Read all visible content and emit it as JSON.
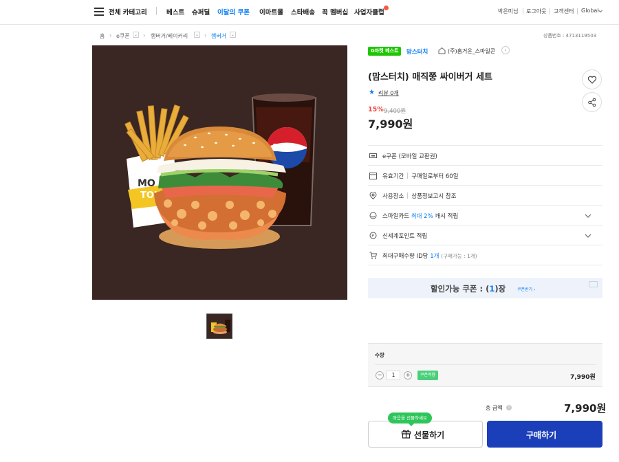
{
  "nav": {
    "all_categories": "전체 카테고리",
    "menus": [
      {
        "label": "베스트",
        "active": false
      },
      {
        "label": "슈퍼딜",
        "active": false
      },
      {
        "label": "이달의 쿠폰",
        "active": true
      },
      {
        "label": "이마트몰",
        "active": false
      },
      {
        "label": "스타배송",
        "active": false
      },
      {
        "label": "꼭 멤버십",
        "active": false
      },
      {
        "label": "사업자클럽",
        "active": false
      }
    ],
    "util": [
      "박은미님",
      "로그아웃",
      "고객센터",
      "Global"
    ]
  },
  "breadcrumb": [
    "홈",
    "e쿠폰",
    "햄버거/베이커리",
    "햄버거"
  ],
  "product_number": "상품번호 : 4713119503",
  "badge": "G마켓 베스트",
  "brand": "맘스터치",
  "shop_name": "(주)홈거운_스마일콘",
  "title": "(맘스터치) 매직쭝 싸이버거 세트",
  "review": "리뷰 0개",
  "discount": "15%",
  "original_price": "9,400원",
  "price": "7,990원",
  "info_rows": {
    "type": "e쿠폰 (모바일 교환권)",
    "validity_label": "유효기간",
    "validity_value": "구매일로부터 60일",
    "place_label": "사용장소",
    "place_value": "상품정보고시 참조",
    "smile_prefix": "스마일카드",
    "smile_blue": "최대 2%",
    "smile_suffix": "캐시 적립",
    "shinsegae": "신세계포인트 적립",
    "maxbuy_prefix": "최대구매수량 ID당",
    "maxbuy_blue": "1개",
    "maxbuy_gray": "(구매가능 : 1개)"
  },
  "coupon": {
    "text_prefix": "할인가능 쿠폰 : (",
    "count": "1",
    "text_suffix": ")장",
    "link": "쿠폰받기 ›"
  },
  "quantity": {
    "label": "수량",
    "value": "1",
    "tag": "쿠폰적용",
    "line_price": "7,990원"
  },
  "total": {
    "label": "총 금액",
    "price": "7,990원"
  },
  "buttons": {
    "gift": "선물하기",
    "gift_bubble": "마음을 선물하세요",
    "buy": "구매하기"
  },
  "image_text": {
    "pepsi": "EPSI",
    "fries_box": "MO\nTOU"
  },
  "colors": {
    "accent_blue": "#0a7ef0",
    "buy_button": "#1b3fb8",
    "gmarket_green": "#1ec800",
    "discount_red": "#f0453a"
  }
}
